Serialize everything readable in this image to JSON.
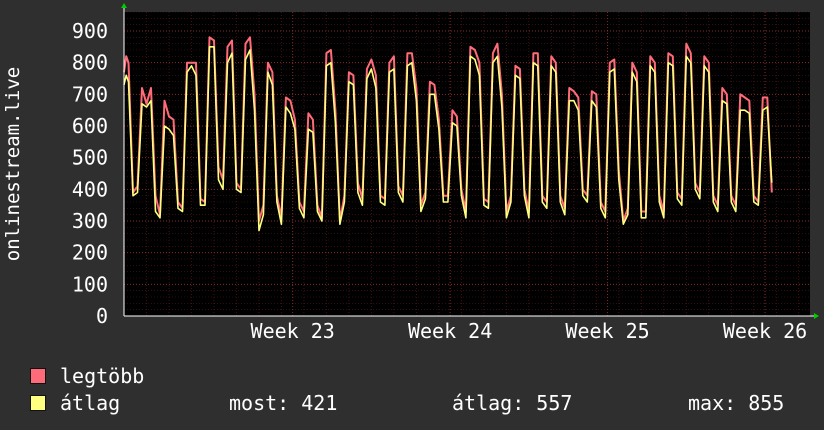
{
  "chart_data": {
    "type": "line",
    "title": "",
    "xlabel": "",
    "ylabel": "onlinestream.live",
    "ylim": [
      0,
      960
    ],
    "yticks": [
      0,
      100,
      200,
      300,
      400,
      500,
      600,
      700,
      800,
      900
    ],
    "xticks": [
      {
        "label": "Week 23",
        "x": 7.5
      },
      {
        "label": "Week 24",
        "x": 14.5
      },
      {
        "label": "Week 25",
        "x": 21.5
      },
      {
        "label": "Week 26",
        "x": 28.5
      }
    ],
    "xlim": [
      0,
      30.5
    ],
    "grid": true,
    "colors": {
      "background": "#2f2f2f",
      "plot_background": "#000000",
      "grid": "#8b2a2a",
      "axis": "#ffffff",
      "text": "#ffffff",
      "series_max": "#ff6b78",
      "series_avg": "#ffff80"
    },
    "series": [
      {
        "name": "legtöbb",
        "color": "#ff6b78",
        "values": [
          [
            0.0,
            770
          ],
          [
            0.1,
            820
          ],
          [
            0.2,
            800
          ],
          [
            0.4,
            390
          ],
          [
            0.6,
            410
          ],
          [
            0.8,
            720
          ],
          [
            1.0,
            670
          ],
          [
            1.2,
            720
          ],
          [
            1.4,
            380
          ],
          [
            1.6,
            320
          ],
          [
            1.8,
            680
          ],
          [
            2.0,
            630
          ],
          [
            2.2,
            620
          ],
          [
            2.4,
            360
          ],
          [
            2.6,
            340
          ],
          [
            2.8,
            800
          ],
          [
            3.0,
            800
          ],
          [
            3.2,
            800
          ],
          [
            3.4,
            370
          ],
          [
            3.6,
            360
          ],
          [
            3.8,
            880
          ],
          [
            4.0,
            870
          ],
          [
            4.2,
            470
          ],
          [
            4.4,
            430
          ],
          [
            4.6,
            850
          ],
          [
            4.8,
            870
          ],
          [
            5.0,
            420
          ],
          [
            5.2,
            400
          ],
          [
            5.4,
            860
          ],
          [
            5.6,
            880
          ],
          [
            5.8,
            700
          ],
          [
            6.0,
            300
          ],
          [
            6.2,
            350
          ],
          [
            6.4,
            800
          ],
          [
            6.6,
            770
          ],
          [
            6.8,
            380
          ],
          [
            7.0,
            310
          ],
          [
            7.2,
            690
          ],
          [
            7.4,
            680
          ],
          [
            7.6,
            620
          ],
          [
            7.8,
            360
          ],
          [
            8.0,
            330
          ],
          [
            8.2,
            640
          ],
          [
            8.4,
            620
          ],
          [
            8.6,
            350
          ],
          [
            8.8,
            310
          ],
          [
            9.0,
            830
          ],
          [
            9.2,
            840
          ],
          [
            9.4,
            650
          ],
          [
            9.6,
            300
          ],
          [
            9.8,
            380
          ],
          [
            10.0,
            770
          ],
          [
            10.2,
            760
          ],
          [
            10.4,
            420
          ],
          [
            10.6,
            370
          ],
          [
            10.8,
            780
          ],
          [
            11.0,
            810
          ],
          [
            11.2,
            760
          ],
          [
            11.4,
            380
          ],
          [
            11.6,
            370
          ],
          [
            11.8,
            800
          ],
          [
            12.0,
            820
          ],
          [
            12.2,
            410
          ],
          [
            12.4,
            380
          ],
          [
            12.6,
            830
          ],
          [
            12.8,
            830
          ],
          [
            13.0,
            720
          ],
          [
            13.2,
            350
          ],
          [
            13.4,
            390
          ],
          [
            13.6,
            740
          ],
          [
            13.8,
            730
          ],
          [
            14.0,
            620
          ],
          [
            14.2,
            380
          ],
          [
            14.4,
            380
          ],
          [
            14.6,
            650
          ],
          [
            14.8,
            630
          ],
          [
            15.0,
            400
          ],
          [
            15.2,
            330
          ],
          [
            15.4,
            850
          ],
          [
            15.6,
            840
          ],
          [
            15.8,
            800
          ],
          [
            16.0,
            370
          ],
          [
            16.2,
            360
          ],
          [
            16.4,
            830
          ],
          [
            16.6,
            860
          ],
          [
            16.8,
            700
          ],
          [
            17.0,
            330
          ],
          [
            17.2,
            380
          ],
          [
            17.4,
            790
          ],
          [
            17.6,
            780
          ],
          [
            17.8,
            400
          ],
          [
            18.0,
            330
          ],
          [
            18.2,
            830
          ],
          [
            18.4,
            830
          ],
          [
            18.6,
            380
          ],
          [
            18.8,
            360
          ],
          [
            19.0,
            820
          ],
          [
            19.2,
            800
          ],
          [
            19.4,
            380
          ],
          [
            19.6,
            340
          ],
          [
            19.8,
            720
          ],
          [
            20.0,
            710
          ],
          [
            20.2,
            690
          ],
          [
            20.4,
            400
          ],
          [
            20.6,
            380
          ],
          [
            20.8,
            710
          ],
          [
            21.0,
            700
          ],
          [
            21.2,
            360
          ],
          [
            21.4,
            330
          ],
          [
            21.6,
            800
          ],
          [
            21.8,
            810
          ],
          [
            22.0,
            460
          ],
          [
            22.2,
            300
          ],
          [
            22.4,
            340
          ],
          [
            22.6,
            800
          ],
          [
            22.8,
            770
          ],
          [
            23.0,
            330
          ],
          [
            23.2,
            330
          ],
          [
            23.4,
            820
          ],
          [
            23.6,
            800
          ],
          [
            23.8,
            380
          ],
          [
            24.0,
            330
          ],
          [
            24.2,
            830
          ],
          [
            24.4,
            820
          ],
          [
            24.6,
            390
          ],
          [
            24.8,
            370
          ],
          [
            25.0,
            860
          ],
          [
            25.2,
            830
          ],
          [
            25.4,
            420
          ],
          [
            25.6,
            390
          ],
          [
            25.8,
            820
          ],
          [
            26.0,
            800
          ],
          [
            26.2,
            380
          ],
          [
            26.4,
            350
          ],
          [
            26.6,
            720
          ],
          [
            26.8,
            700
          ],
          [
            27.0,
            380
          ],
          [
            27.2,
            350
          ],
          [
            27.4,
            700
          ],
          [
            27.6,
            690
          ],
          [
            27.8,
            680
          ],
          [
            28.0,
            380
          ],
          [
            28.2,
            360
          ],
          [
            28.4,
            690
          ],
          [
            28.6,
            690
          ],
          [
            28.8,
            390
          ]
        ]
      },
      {
        "name": "átlag",
        "color": "#ffff80",
        "values": [
          [
            0.0,
            730
          ],
          [
            0.1,
            760
          ],
          [
            0.2,
            740
          ],
          [
            0.4,
            380
          ],
          [
            0.6,
            390
          ],
          [
            0.8,
            670
          ],
          [
            1.0,
            660
          ],
          [
            1.2,
            680
          ],
          [
            1.4,
            330
          ],
          [
            1.6,
            310
          ],
          [
            1.8,
            600
          ],
          [
            2.0,
            590
          ],
          [
            2.2,
            570
          ],
          [
            2.4,
            340
          ],
          [
            2.6,
            330
          ],
          [
            2.8,
            770
          ],
          [
            3.0,
            790
          ],
          [
            3.2,
            760
          ],
          [
            3.4,
            350
          ],
          [
            3.6,
            350
          ],
          [
            3.8,
            850
          ],
          [
            4.0,
            850
          ],
          [
            4.2,
            430
          ],
          [
            4.4,
            400
          ],
          [
            4.6,
            800
          ],
          [
            4.8,
            830
          ],
          [
            5.0,
            400
          ],
          [
            5.2,
            390
          ],
          [
            5.4,
            810
          ],
          [
            5.6,
            840
          ],
          [
            5.8,
            650
          ],
          [
            6.0,
            270
          ],
          [
            6.2,
            320
          ],
          [
            6.4,
            770
          ],
          [
            6.6,
            730
          ],
          [
            6.8,
            360
          ],
          [
            7.0,
            290
          ],
          [
            7.2,
            660
          ],
          [
            7.4,
            640
          ],
          [
            7.6,
            590
          ],
          [
            7.8,
            340
          ],
          [
            8.0,
            310
          ],
          [
            8.2,
            590
          ],
          [
            8.4,
            580
          ],
          [
            8.6,
            330
          ],
          [
            8.8,
            300
          ],
          [
            9.0,
            790
          ],
          [
            9.2,
            800
          ],
          [
            9.4,
            610
          ],
          [
            9.6,
            290
          ],
          [
            9.8,
            360
          ],
          [
            10.0,
            740
          ],
          [
            10.2,
            730
          ],
          [
            10.4,
            390
          ],
          [
            10.6,
            350
          ],
          [
            10.8,
            750
          ],
          [
            11.0,
            780
          ],
          [
            11.2,
            720
          ],
          [
            11.4,
            360
          ],
          [
            11.6,
            350
          ],
          [
            11.8,
            770
          ],
          [
            12.0,
            780
          ],
          [
            12.2,
            390
          ],
          [
            12.4,
            360
          ],
          [
            12.6,
            790
          ],
          [
            12.8,
            800
          ],
          [
            13.0,
            680
          ],
          [
            13.2,
            330
          ],
          [
            13.4,
            370
          ],
          [
            13.6,
            700
          ],
          [
            13.8,
            700
          ],
          [
            14.0,
            590
          ],
          [
            14.2,
            360
          ],
          [
            14.4,
            360
          ],
          [
            14.6,
            610
          ],
          [
            14.8,
            600
          ],
          [
            15.0,
            380
          ],
          [
            15.2,
            310
          ],
          [
            15.4,
            820
          ],
          [
            15.6,
            810
          ],
          [
            15.8,
            760
          ],
          [
            16.0,
            350
          ],
          [
            16.2,
            340
          ],
          [
            16.4,
            800
          ],
          [
            16.6,
            820
          ],
          [
            16.8,
            660
          ],
          [
            17.0,
            310
          ],
          [
            17.2,
            360
          ],
          [
            17.4,
            760
          ],
          [
            17.6,
            750
          ],
          [
            17.8,
            380
          ],
          [
            18.0,
            310
          ],
          [
            18.2,
            800
          ],
          [
            18.4,
            790
          ],
          [
            18.6,
            360
          ],
          [
            18.8,
            340
          ],
          [
            19.0,
            790
          ],
          [
            19.2,
            770
          ],
          [
            19.4,
            360
          ],
          [
            19.6,
            320
          ],
          [
            19.8,
            680
          ],
          [
            20.0,
            680
          ],
          [
            20.2,
            650
          ],
          [
            20.4,
            380
          ],
          [
            20.6,
            360
          ],
          [
            20.8,
            680
          ],
          [
            21.0,
            660
          ],
          [
            21.2,
            340
          ],
          [
            21.4,
            310
          ],
          [
            21.6,
            770
          ],
          [
            21.8,
            780
          ],
          [
            22.0,
            430
          ],
          [
            22.2,
            290
          ],
          [
            22.4,
            320
          ],
          [
            22.6,
            770
          ],
          [
            22.8,
            740
          ],
          [
            23.0,
            310
          ],
          [
            23.2,
            310
          ],
          [
            23.4,
            790
          ],
          [
            23.6,
            770
          ],
          [
            23.8,
            360
          ],
          [
            24.0,
            310
          ],
          [
            24.2,
            800
          ],
          [
            24.4,
            790
          ],
          [
            24.6,
            370
          ],
          [
            24.8,
            350
          ],
          [
            25.0,
            820
          ],
          [
            25.2,
            800
          ],
          [
            25.4,
            400
          ],
          [
            25.6,
            370
          ],
          [
            25.8,
            790
          ],
          [
            26.0,
            770
          ],
          [
            26.2,
            360
          ],
          [
            26.4,
            330
          ],
          [
            26.6,
            680
          ],
          [
            26.8,
            670
          ],
          [
            27.0,
            360
          ],
          [
            27.2,
            330
          ],
          [
            27.4,
            650
          ],
          [
            27.6,
            650
          ],
          [
            27.8,
            640
          ],
          [
            28.0,
            360
          ],
          [
            28.2,
            350
          ],
          [
            28.4,
            650
          ],
          [
            28.6,
            660
          ],
          [
            28.8,
            421
          ]
        ]
      }
    ]
  },
  "legend": {
    "max_label": "legtöbb",
    "avg_label": "átlag",
    "now_stat": "most: 421",
    "avg_stat": "átlag: 557",
    "max_stat": "max: 855"
  }
}
